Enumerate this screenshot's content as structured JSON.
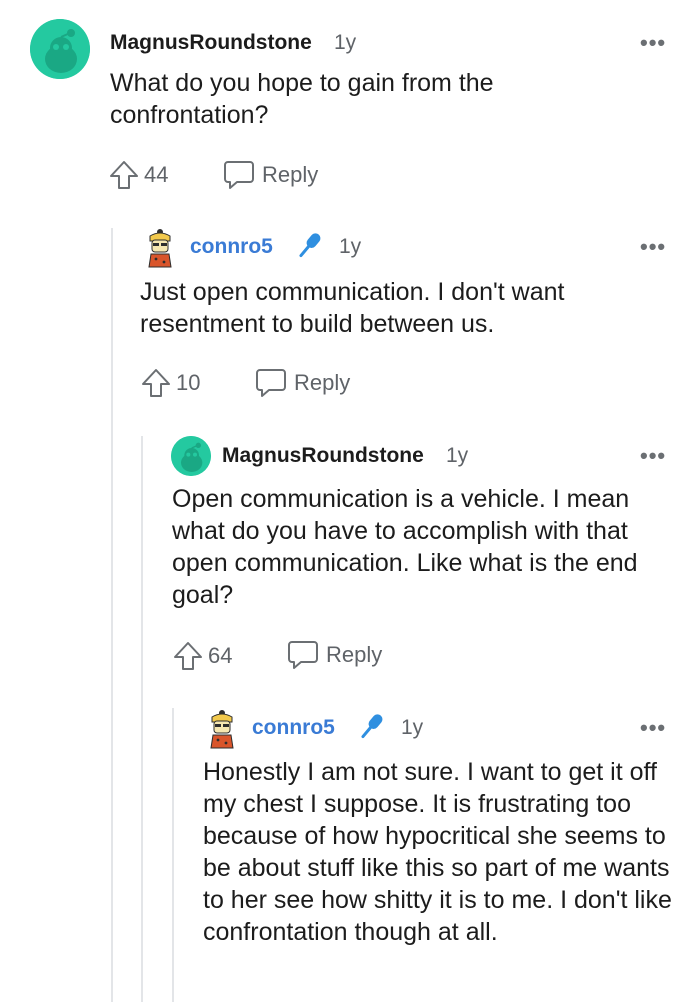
{
  "comments": [
    {
      "username": "MagnusRoundstone",
      "time": "1y",
      "avatar": "snoo-avatar",
      "body": "What do you hope to gain from the confrontation?",
      "votes": "44",
      "reply_label": "Reply",
      "more_label": "•••"
    },
    {
      "username": "connro5",
      "time": "1y",
      "avatar": "character-avatar",
      "flair_icon": "microphone-icon",
      "body": "Just open communication. I don't want resentment to build between us.",
      "votes": "10",
      "reply_label": "Reply",
      "more_label": "•••"
    },
    {
      "username": "MagnusRoundstone",
      "time": "1y",
      "avatar": "snoo-avatar",
      "body": "Open communication is a vehicle. I mean what do you have to accomplish with that open communication. Like what is the end goal?",
      "votes": "64",
      "reply_label": "Reply",
      "more_label": "•••"
    },
    {
      "username": "connro5",
      "time": "1y",
      "avatar": "character-avatar",
      "flair_icon": "microphone-icon",
      "body": "Honestly I am not sure. I want to get it off my chest I suppose. It is frustrating too because of how hypocritical she seems to be about stuff like this so part of me wants to her see how shitty it is to me. I don't like confrontation though at all.",
      "more_label": "•••"
    }
  ],
  "colors": {
    "snoo_bg": "#24c9a0",
    "op_username": "#3a7bd5",
    "mic": "#2f8fe0",
    "thread_line": "#e3e5e8"
  }
}
